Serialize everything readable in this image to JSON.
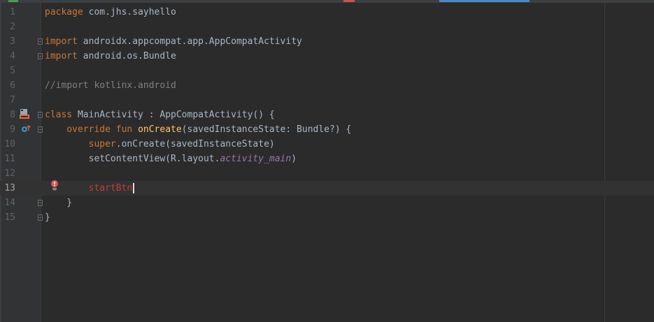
{
  "editor": {
    "lines": [
      {
        "num": "1",
        "tokens": [
          {
            "t": "kw",
            "v": "package "
          },
          {
            "t": "plain",
            "v": "com.jhs.sayhello"
          }
        ]
      },
      {
        "num": "2",
        "tokens": []
      },
      {
        "num": "3",
        "tokens": [
          {
            "t": "kw",
            "v": "import "
          },
          {
            "t": "plain",
            "v": "androidx.appcompat.app.AppCompatActivity"
          }
        ]
      },
      {
        "num": "4",
        "tokens": [
          {
            "t": "kw",
            "v": "import "
          },
          {
            "t": "plain",
            "v": "android.os.Bundle"
          }
        ]
      },
      {
        "num": "5",
        "tokens": []
      },
      {
        "num": "6",
        "tokens": [
          {
            "t": "cm",
            "v": "//import kotlinx.android"
          }
        ]
      },
      {
        "num": "7",
        "tokens": []
      },
      {
        "num": "8",
        "tokens": [
          {
            "t": "kw",
            "v": "class "
          },
          {
            "t": "plain",
            "v": "MainActivity : AppCompatActivity() {"
          }
        ]
      },
      {
        "num": "9",
        "tokens": [
          {
            "t": "plain",
            "v": "    "
          },
          {
            "t": "kw",
            "v": "override fun "
          },
          {
            "t": "fn",
            "v": "onCreate"
          },
          {
            "t": "plain",
            "v": "(savedInstanceState: Bundle?) {"
          }
        ]
      },
      {
        "num": "10",
        "tokens": [
          {
            "t": "plain",
            "v": "        "
          },
          {
            "t": "kw",
            "v": "super"
          },
          {
            "t": "plain",
            "v": ".onCreate(savedInstanceState)"
          }
        ]
      },
      {
        "num": "11",
        "tokens": [
          {
            "t": "plain",
            "v": "        setContentView(R.layout."
          },
          {
            "t": "it",
            "v": "activity_main"
          },
          {
            "t": "plain",
            "v": ")"
          }
        ]
      },
      {
        "num": "12",
        "tokens": []
      },
      {
        "num": "13",
        "tokens": [
          {
            "t": "plain",
            "v": "        "
          },
          {
            "t": "err",
            "v": "startBtn"
          }
        ],
        "current": true,
        "caret": true
      },
      {
        "num": "14",
        "tokens": [
          {
            "t": "plain",
            "v": "    }"
          }
        ]
      },
      {
        "num": "15",
        "tokens": [
          {
            "t": "plain",
            "v": "}"
          }
        ]
      }
    ],
    "folds": [
      3,
      4,
      8,
      9,
      14,
      15
    ],
    "gutter_icons": [
      {
        "line": 8,
        "name": "layout-file-icon"
      },
      {
        "line": 9,
        "name": "override-method-icon"
      },
      {
        "line": 13,
        "name": "error-bulb-icon"
      }
    ]
  },
  "colors": {
    "background": "#2b2b2b",
    "gutter": "#313335",
    "keyword": "#cc7832",
    "function": "#ffc66d",
    "comment": "#808080",
    "italic_member": "#9876aa",
    "error": "#bc3f3c",
    "text": "#a9b7c6"
  }
}
